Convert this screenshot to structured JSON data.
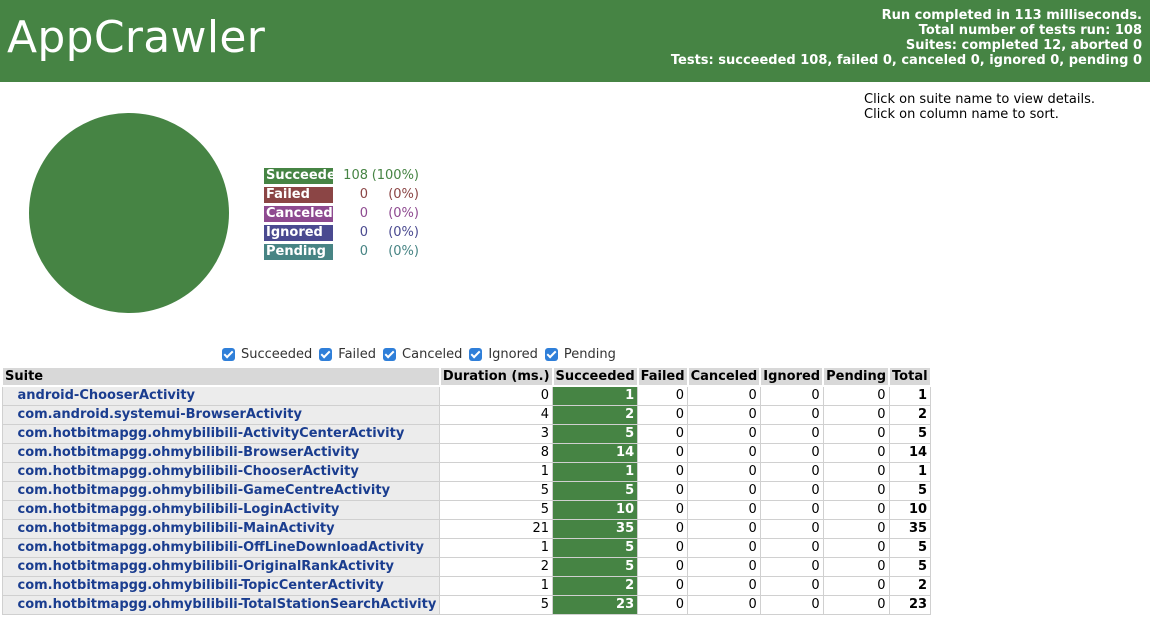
{
  "header": {
    "title": "AppCrawler",
    "summary": [
      "Run completed in 113 milliseconds.",
      "Total number of tests run: 108",
      "Suites: completed 12, aborted 0",
      "Tests: succeeded 108, failed 0, canceled 0, ignored 0, pending 0"
    ]
  },
  "hint": {
    "line1": "Click on suite name to view details.",
    "line2": "Click on column name to sort."
  },
  "colors": {
    "succeeded": "#468444",
    "failed": "#8b4545",
    "canceled": "#8e4a90",
    "ignored": "#4a4a90",
    "pending": "#478484"
  },
  "chart_data": {
    "type": "pie",
    "categories": [
      "Succeeded",
      "Failed",
      "Canceled",
      "Ignored",
      "Pending"
    ],
    "values": [
      108,
      0,
      0,
      0,
      0
    ]
  },
  "legend": [
    {
      "label": "Succeeded",
      "count": "108",
      "pct": "(100%)",
      "color": "#468444",
      "text_color": "#468444"
    },
    {
      "label": "Failed",
      "count": "0",
      "pct": "(0%)",
      "color": "#8b4545",
      "text_color": "#8b4545"
    },
    {
      "label": "Canceled",
      "count": "0",
      "pct": "(0%)",
      "color": "#8e4a90",
      "text_color": "#8e4a90"
    },
    {
      "label": "Ignored",
      "count": "0",
      "pct": "(0%)",
      "color": "#4a4a90",
      "text_color": "#4a4a90"
    },
    {
      "label": "Pending",
      "count": "0",
      "pct": "(0%)",
      "color": "#478484",
      "text_color": "#478484"
    }
  ],
  "filters": [
    "Succeeded",
    "Failed",
    "Canceled",
    "Ignored",
    "Pending"
  ],
  "table": {
    "headers": [
      "Suite",
      "Duration (ms.)",
      "Succeeded",
      "Failed",
      "Canceled",
      "Ignored",
      "Pending",
      "Total"
    ],
    "rows": [
      [
        "android-ChooserActivity",
        "0",
        "1",
        "0",
        "0",
        "0",
        "0",
        "1"
      ],
      [
        "com.android.systemui-BrowserActivity",
        "4",
        "2",
        "0",
        "0",
        "0",
        "0",
        "2"
      ],
      [
        "com.hotbitmapgg.ohmybilibili-ActivityCenterActivity",
        "3",
        "5",
        "0",
        "0",
        "0",
        "0",
        "5"
      ],
      [
        "com.hotbitmapgg.ohmybilibili-BrowserActivity",
        "8",
        "14",
        "0",
        "0",
        "0",
        "0",
        "14"
      ],
      [
        "com.hotbitmapgg.ohmybilibili-ChooserActivity",
        "1",
        "1",
        "0",
        "0",
        "0",
        "0",
        "1"
      ],
      [
        "com.hotbitmapgg.ohmybilibili-GameCentreActivity",
        "5",
        "5",
        "0",
        "0",
        "0",
        "0",
        "5"
      ],
      [
        "com.hotbitmapgg.ohmybilibili-LoginActivity",
        "5",
        "10",
        "0",
        "0",
        "0",
        "0",
        "10"
      ],
      [
        "com.hotbitmapgg.ohmybilibili-MainActivity",
        "21",
        "35",
        "0",
        "0",
        "0",
        "0",
        "35"
      ],
      [
        "com.hotbitmapgg.ohmybilibili-OffLineDownloadActivity",
        "1",
        "5",
        "0",
        "0",
        "0",
        "0",
        "5"
      ],
      [
        "com.hotbitmapgg.ohmybilibili-OriginalRankActivity",
        "2",
        "5",
        "0",
        "0",
        "0",
        "0",
        "5"
      ],
      [
        "com.hotbitmapgg.ohmybilibili-TopicCenterActivity",
        "1",
        "2",
        "0",
        "0",
        "0",
        "0",
        "2"
      ],
      [
        "com.hotbitmapgg.ohmybilibili-TotalStationSearchActivity",
        "5",
        "23",
        "0",
        "0",
        "0",
        "0",
        "23"
      ]
    ]
  }
}
